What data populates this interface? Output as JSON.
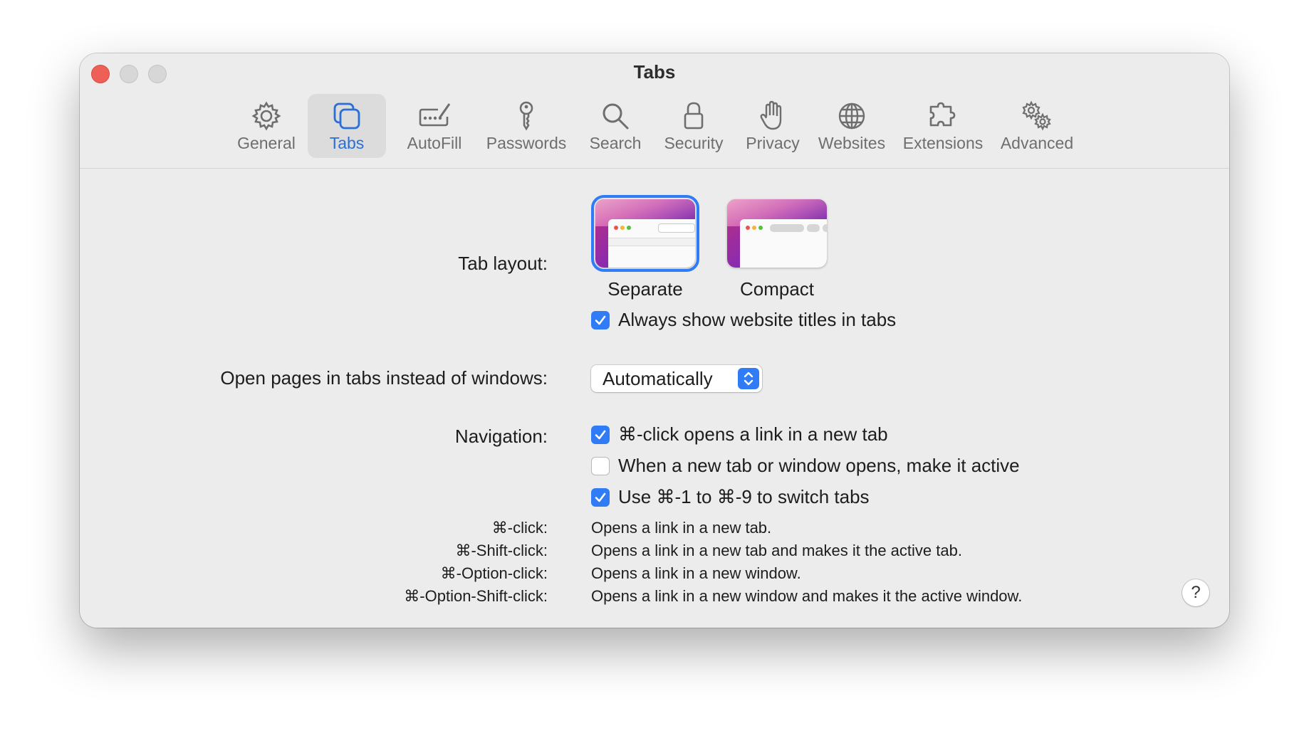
{
  "window": {
    "title": "Tabs"
  },
  "toolbar": {
    "items": [
      {
        "label": "General",
        "icon": "gear-icon"
      },
      {
        "label": "Tabs",
        "icon": "tabs-icon",
        "active": true
      },
      {
        "label": "AutoFill",
        "icon": "autofill-icon"
      },
      {
        "label": "Passwords",
        "icon": "key-icon"
      },
      {
        "label": "Search",
        "icon": "search-icon"
      },
      {
        "label": "Security",
        "icon": "lock-icon"
      },
      {
        "label": "Privacy",
        "icon": "hand-icon"
      },
      {
        "label": "Websites",
        "icon": "globe-icon"
      },
      {
        "label": "Extensions",
        "icon": "puzzle-icon"
      },
      {
        "label": "Advanced",
        "icon": "gears-icon"
      }
    ]
  },
  "tab_layout": {
    "label": "Tab layout:",
    "options": [
      {
        "label": "Separate",
        "selected": true
      },
      {
        "label": "Compact",
        "selected": false
      }
    ],
    "always_show_titles": {
      "label": "Always show website titles in tabs",
      "checked": true
    }
  },
  "open_pages": {
    "label": "Open pages in tabs instead of windows:",
    "value": "Automatically"
  },
  "navigation": {
    "label": "Navigation:",
    "options": [
      {
        "label": "⌘-click opens a link in a new tab",
        "checked": true
      },
      {
        "label": "When a new tab or window opens, make it active",
        "checked": false
      },
      {
        "label": "Use ⌘-1 to ⌘-9 to switch tabs",
        "checked": true
      }
    ]
  },
  "shortcuts": [
    {
      "key": "⌘-click:",
      "desc": "Opens a link in a new tab."
    },
    {
      "key": "⌘-Shift-click:",
      "desc": "Opens a link in a new tab and makes it the active tab."
    },
    {
      "key": "⌘-Option-click:",
      "desc": "Opens a link in a new window."
    },
    {
      "key": "⌘-Option-Shift-click:",
      "desc": "Opens a link in a new window and makes it the active window."
    }
  ],
  "help": {
    "label": "?"
  },
  "colors": {
    "accent": "#2f7cf6",
    "close": "#ee5f58",
    "background": "#ececec"
  }
}
